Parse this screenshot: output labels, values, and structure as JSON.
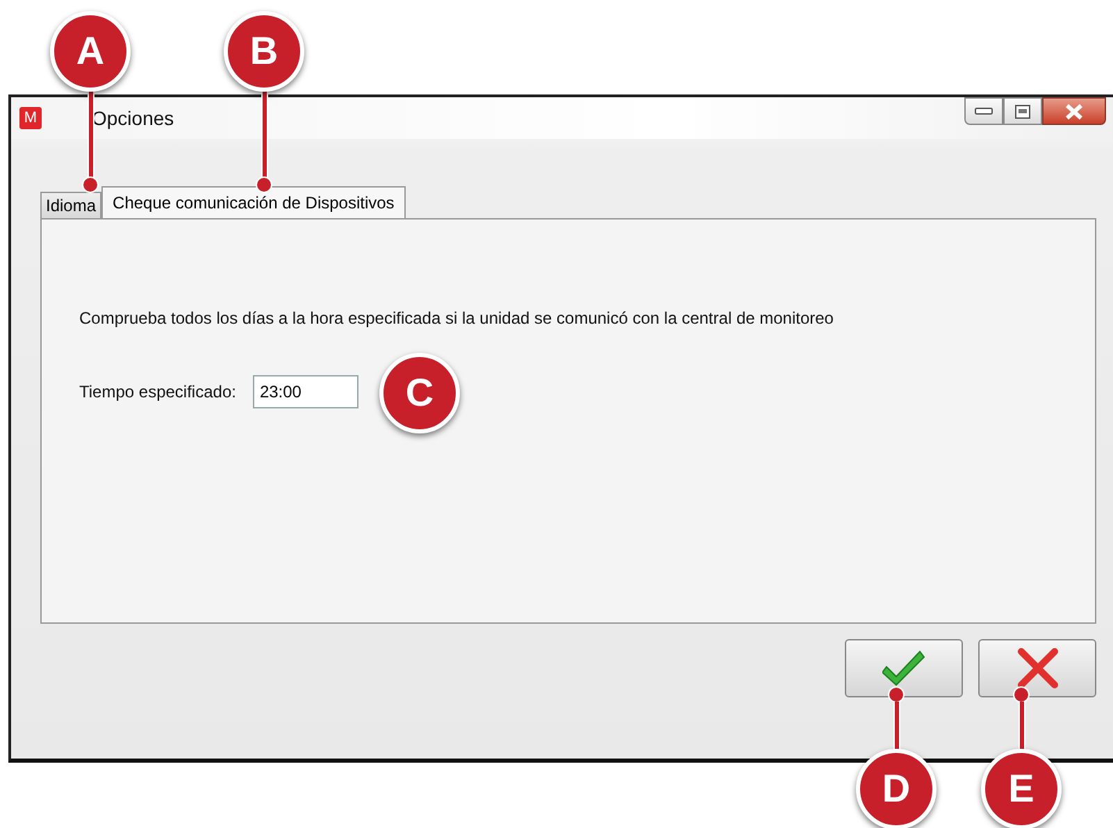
{
  "window": {
    "icon_letter": "M",
    "title": "Opciones"
  },
  "tabs": [
    {
      "label": "Idioma",
      "selected": false
    },
    {
      "label": "Cheque comunicación de Dispositivos",
      "selected": true
    }
  ],
  "panel": {
    "description": "Comprueba todos los días a la hora especificada si la unidad se comunicó con la central de monitoreo",
    "time_label": "Tiempo especificado:",
    "time_value": "23:00"
  },
  "buttons": [
    {
      "kind": "accept"
    },
    {
      "kind": "cancel"
    }
  ],
  "callouts": [
    {
      "letter": "A"
    },
    {
      "letter": "B"
    },
    {
      "letter": "C"
    },
    {
      "letter": "D"
    },
    {
      "letter": "E"
    }
  ]
}
